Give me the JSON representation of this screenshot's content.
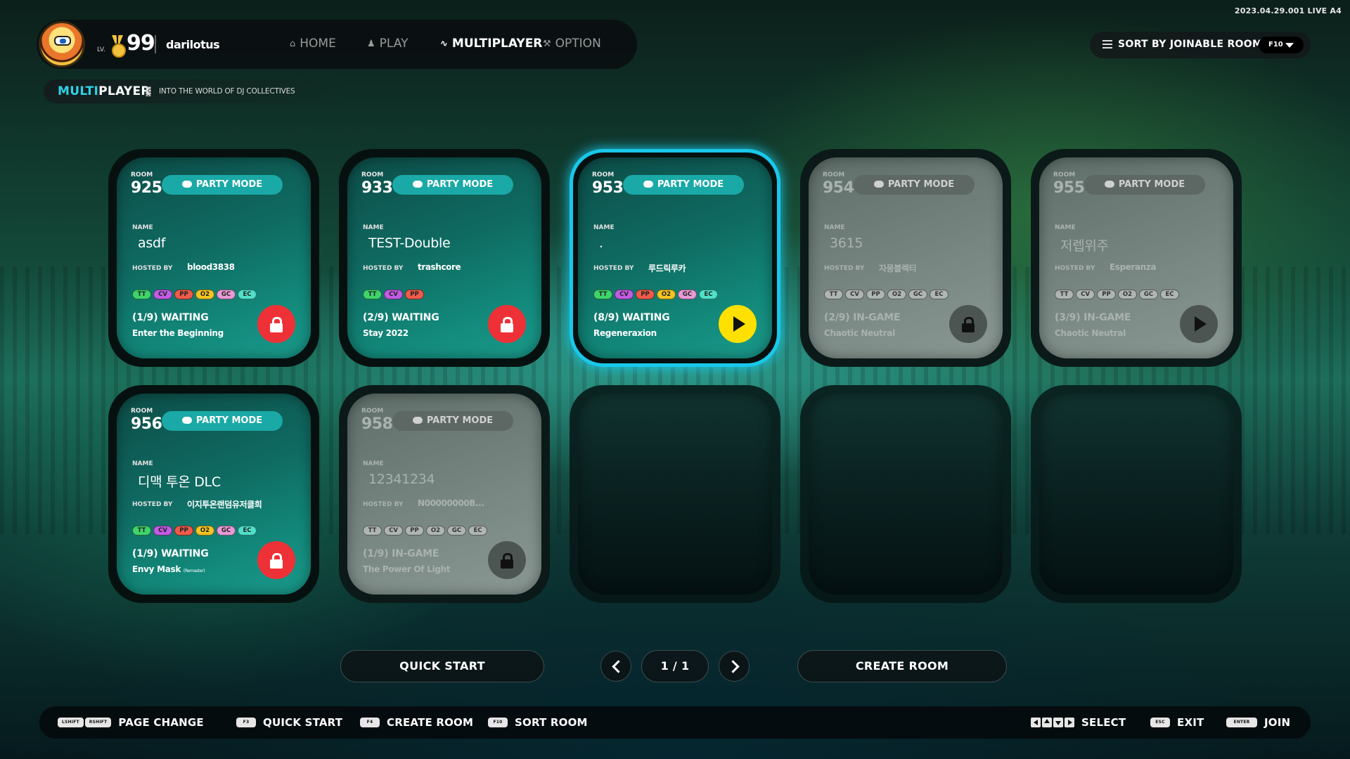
{
  "version": "2023.04.29.001 LIVE A4",
  "player": {
    "lv_label": "LV.",
    "level": "99",
    "username": "darilotus"
  },
  "nav": [
    {
      "label": "HOME",
      "icon": "home-icon"
    },
    {
      "label": "PLAY",
      "icon": "person-icon"
    },
    {
      "label": "MULTIPLAYER",
      "icon": "rss-icon"
    },
    {
      "label": "OPTION",
      "icon": "wrench-icon"
    }
  ],
  "breadcrumb": {
    "title_highlight": "MULTI",
    "title_rest": "PLAYER",
    "subtitle": "INTO THE WORLD OF DJ COLLECTIVES"
  },
  "sort": {
    "label": "SORT BY JOINABLE ROOM",
    "key": "F10"
  },
  "labels": {
    "room": "ROOM",
    "party_mode": "PARTY MODE",
    "name": "NAME",
    "hosted_by": "HOSTED BY"
  },
  "colors": {
    "accent": "#19c8ea",
    "lock": "#ee3137",
    "play": "#ffe000",
    "tag_TT": "#3fd46b",
    "tag_CV": "#c25be3",
    "tag_PP": "#ef5a4a",
    "tag_O2": "#f2c524",
    "tag_GC": "#e99ad6",
    "tag_EC": "#4fe0c9"
  },
  "rooms": [
    {
      "number": "925",
      "name": "asdf",
      "host": "blood3838",
      "tags": [
        "TT",
        "CV",
        "PP",
        "O2",
        "GC",
        "EC"
      ],
      "status": "(1/9) WAITING",
      "song": "Enter the Beginning",
      "song_suffix": "",
      "action": "lock",
      "state": "waiting",
      "selected": false
    },
    {
      "number": "933",
      "name": "TEST-Double",
      "host": "trashcore",
      "tags": [
        "TT",
        "CV",
        "PP"
      ],
      "status": "(2/9) WAITING",
      "song": "Stay 2022",
      "song_suffix": "",
      "action": "lock",
      "state": "waiting",
      "selected": false
    },
    {
      "number": "953",
      "name": ".",
      "host": "루드릭루카",
      "tags": [
        "TT",
        "CV",
        "PP",
        "O2",
        "GC",
        "EC"
      ],
      "status": "(8/9) WAITING",
      "song": "Regeneraxion",
      "song_suffix": "",
      "action": "play",
      "state": "waiting",
      "selected": true
    },
    {
      "number": "954",
      "name": "3615",
      "host": "자몽블렉티",
      "tags": [
        "TT",
        "CV",
        "PP",
        "O2",
        "GC",
        "EC"
      ],
      "status": "(2/9) IN-GAME",
      "song": "Chaotic Neutral",
      "song_suffix": "",
      "action": "lock",
      "state": "ingame",
      "selected": false
    },
    {
      "number": "955",
      "name": "저렙위주",
      "host": "Esperanza",
      "tags": [
        "TT",
        "CV",
        "PP",
        "O2",
        "GC",
        "EC"
      ],
      "status": "(3/9) IN-GAME",
      "song": "Chaotic Neutral",
      "song_suffix": "",
      "action": "play",
      "state": "ingame",
      "selected": false
    },
    {
      "number": "956",
      "name": "디맥 투온 DLC",
      "host": "이지투온랜덤유저클희",
      "tags": [
        "TT",
        "CV",
        "PP",
        "O2",
        "GC",
        "EC"
      ],
      "status": "(1/9) WAITING",
      "song": "Envy Mask",
      "song_suffix": "(Remaster)",
      "action": "lock",
      "state": "waiting",
      "selected": false
    },
    {
      "number": "958",
      "name": "12341234",
      "host": "N00000000B...",
      "tags": [
        "TT",
        "CV",
        "PP",
        "O2",
        "GC",
        "EC"
      ],
      "status": "(1/9) IN-GAME",
      "song": "The Power Of Light",
      "song_suffix": "",
      "action": "lock",
      "state": "ingame",
      "selected": false
    }
  ],
  "bottom": {
    "quick_start": "QUICK START",
    "create_room": "CREATE ROOM",
    "page": "1 / 1"
  },
  "footer": {
    "page_change": {
      "keys": [
        "LSHIFT",
        "RSHIFT"
      ],
      "label": "PAGE CHANGE"
    },
    "quick_start": {
      "key": "F3",
      "label": "QUICK START"
    },
    "create_room": {
      "key": "F4",
      "label": "CREATE ROOM"
    },
    "sort_room": {
      "key": "F10",
      "label": "SORT ROOM"
    },
    "select": {
      "label": "SELECT"
    },
    "exit": {
      "key": "ESC",
      "label": "EXIT"
    },
    "join": {
      "key": "ENTER",
      "label": "JOIN"
    }
  }
}
